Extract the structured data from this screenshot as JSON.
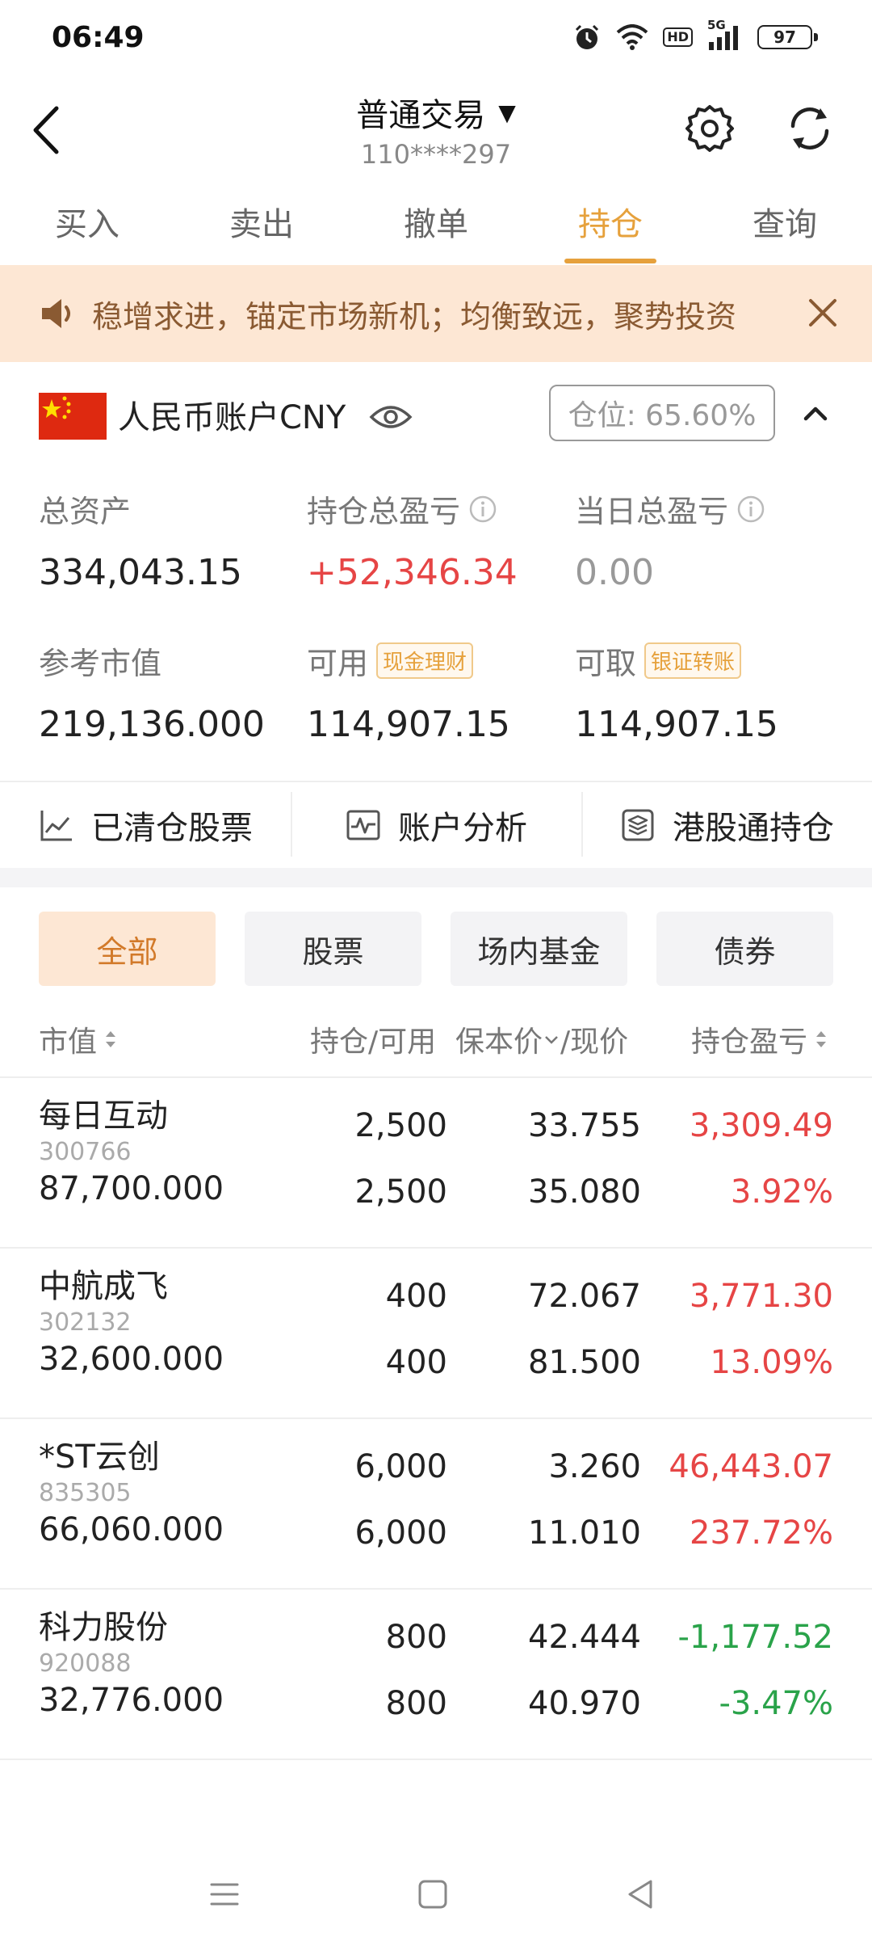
{
  "status_bar": {
    "time": "06:49",
    "battery": "97",
    "network": "5G",
    "hd": "HD"
  },
  "header": {
    "title": "普通交易",
    "account_number": "110****297"
  },
  "tabs": [
    "买入",
    "卖出",
    "撤单",
    "持仓",
    "查询"
  ],
  "active_tab": "持仓",
  "notice": {
    "text": "稳增求进，锚定市场新机；均衡致远，聚势投资"
  },
  "account": {
    "name": "人民币账户CNY",
    "position_label": "仓位: 65.60%",
    "stats": {
      "total_assets_label": "总资产",
      "total_assets": "334,043.15",
      "position_pl_label": "持仓总盈亏",
      "position_pl": "+52,346.34",
      "daily_pl_label": "当日总盈亏",
      "daily_pl": "0.00",
      "market_value_label": "参考市值",
      "market_value": "219,136.000",
      "available_label": "可用",
      "available_tag": "现金理财",
      "available": "114,907.15",
      "withdrawable_label": "可取",
      "withdrawable_tag": "银证转账",
      "withdrawable": "114,907.15"
    }
  },
  "quick_links": [
    "已清仓股票",
    "账户分析",
    "港股通持仓"
  ],
  "filters": [
    "全部",
    "股票",
    "场内基金",
    "债券"
  ],
  "active_filter": "全部",
  "table_headers": {
    "market_value": "市值",
    "qty": "持仓/可用",
    "price": "保本价",
    "price_suffix": "/现价",
    "pl": "持仓盈亏"
  },
  "holdings": [
    {
      "name": "每日互动",
      "code": "300766",
      "market_value": "87,700.000",
      "qty": "2,500",
      "available": "2,500",
      "breakeven": "33.755",
      "price": "35.080",
      "pl": "3,309.49",
      "pl_pct": "3.92%",
      "trend": "up"
    },
    {
      "name": "中航成飞",
      "code": "302132",
      "market_value": "32,600.000",
      "qty": "400",
      "available": "400",
      "breakeven": "72.067",
      "price": "81.500",
      "pl": "3,771.30",
      "pl_pct": "13.09%",
      "trend": "up"
    },
    {
      "name": "*ST云创",
      "code": "835305",
      "market_value": "66,060.000",
      "qty": "6,000",
      "available": "6,000",
      "breakeven": "3.260",
      "price": "11.010",
      "pl": "46,443.07",
      "pl_pct": "237.72%",
      "trend": "up"
    },
    {
      "name": "科力股份",
      "code": "920088",
      "market_value": "32,776.000",
      "qty": "800",
      "available": "800",
      "breakeven": "42.444",
      "price": "40.970",
      "pl": "-1,177.52",
      "pl_pct": "-3.47%",
      "trend": "down"
    }
  ],
  "colors": {
    "accent": "#e6a13c",
    "up": "#e64545",
    "down": "#2aa34a",
    "notice_bg": "#fde7d4"
  }
}
